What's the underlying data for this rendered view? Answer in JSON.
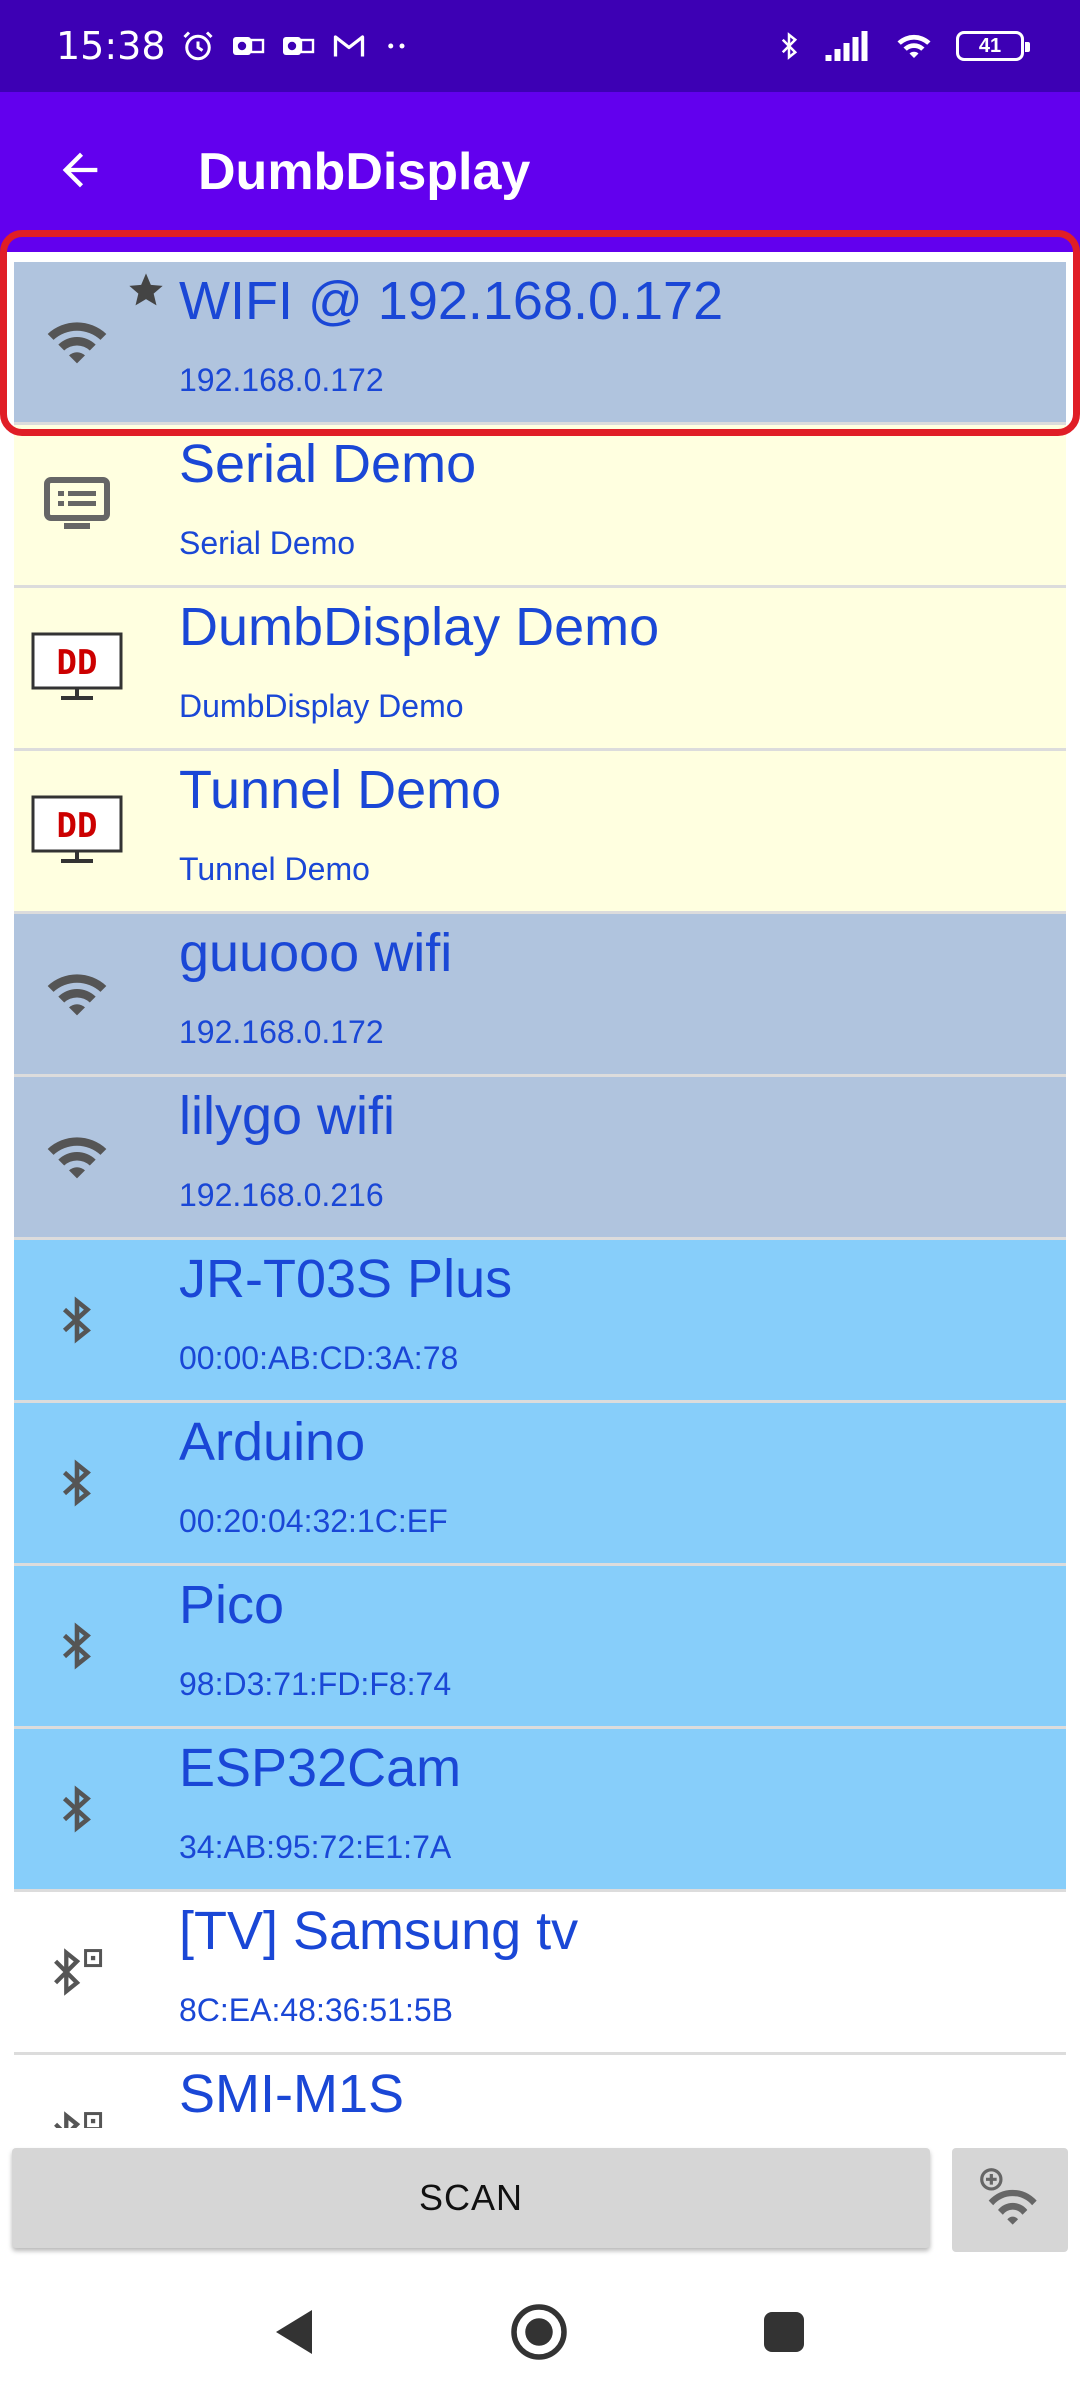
{
  "status_bar": {
    "time": "15:38",
    "battery": "41",
    "left_icons": [
      "alarm-icon",
      "outlook-icon",
      "outlook-icon",
      "gmail-icon",
      "more-dots-icon"
    ],
    "right_icons": [
      "bluetooth-icon",
      "signal-icon",
      "wifi-icon",
      "battery-icon"
    ]
  },
  "app_bar": {
    "title": "DumbDisplay",
    "back_icon": "arrow-back-icon"
  },
  "devices": [
    {
      "title": "WIFI @ 192.168.0.172",
      "subtitle": "192.168.0.172",
      "kind": "wifi",
      "starred": true,
      "color": "#b0c4de"
    },
    {
      "title": "Serial Demo",
      "subtitle": "Serial Demo",
      "kind": "serial",
      "color": "#ffffe0"
    },
    {
      "title": "DumbDisplay Demo",
      "subtitle": "DumbDisplay Demo",
      "kind": "dd",
      "color": "#ffffe0"
    },
    {
      "title": "Tunnel Demo",
      "subtitle": "Tunnel Demo",
      "kind": "dd",
      "color": "#ffffe0"
    },
    {
      "title": "guuooo wifi",
      "subtitle": "192.168.0.172",
      "kind": "wifi",
      "color": "#b0c4de"
    },
    {
      "title": "lilygo wifi",
      "subtitle": "192.168.0.216",
      "kind": "wifi",
      "color": "#b0c4de"
    },
    {
      "title": "JR-T03S Plus",
      "subtitle": "00:00:AB:CD:3A:78",
      "kind": "bt",
      "color": "#87cefa"
    },
    {
      "title": "Arduino",
      "subtitle": "00:20:04:32:1C:EF",
      "kind": "bt",
      "color": "#87cefa"
    },
    {
      "title": "Pico",
      "subtitle": "98:D3:71:FD:F8:74",
      "kind": "bt",
      "color": "#87cefa"
    },
    {
      "title": "ESP32Cam",
      "subtitle": "34:AB:95:72:E1:7A",
      "kind": "bt",
      "color": "#87cefa"
    },
    {
      "title": "[TV] Samsung tv",
      "subtitle": "8C:EA:48:36:51:5B",
      "kind": "bt-le",
      "color": "#ffffff"
    },
    {
      "title": "SMI-M1S",
      "subtitle": "",
      "kind": "bt-le",
      "color": "#ffffff"
    }
  ],
  "dd_icon_text": "DD",
  "bottom_bar": {
    "scan_label": "SCAN",
    "add_wifi_icon": "add-wifi-icon"
  },
  "nav_bar": {
    "icons": [
      "nav-back-icon",
      "nav-home-icon",
      "nav-recents-icon"
    ]
  },
  "colors": {
    "status_bar": "#3d00b4",
    "app_bar": "#6200ee",
    "text": "#1a47d6",
    "highlight": "#e01e26"
  }
}
